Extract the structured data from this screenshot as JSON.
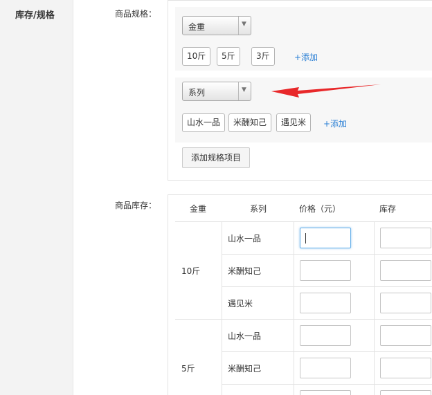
{
  "section": {
    "title": "库存/规格"
  },
  "spec": {
    "label": "商品规格：",
    "groups": [
      {
        "select_value": "金重",
        "values": [
          "10斤",
          "5斤",
          "3斤"
        ],
        "add_label": "+添加"
      },
      {
        "select_value": "系列",
        "values": [
          "山水一品",
          "米酬知己",
          "遇见米"
        ],
        "add_label": "+添加"
      }
    ],
    "add_item_button": "添加规格项目"
  },
  "stock": {
    "label": "商品库存：",
    "headers": [
      "金重",
      "系列",
      "价格（元）",
      "库存"
    ],
    "weights": [
      "10斤",
      "5斤"
    ],
    "series_rows": [
      "山水一品",
      "米酬知己",
      "遇见米",
      "山水一品",
      "米酬知己"
    ]
  },
  "colors": {
    "link": "#2a7fd4",
    "arrow": "#e8282a",
    "focus": "#66afe9"
  }
}
